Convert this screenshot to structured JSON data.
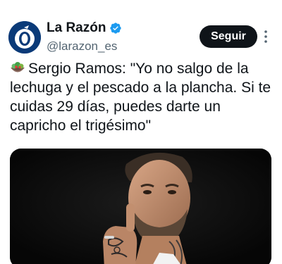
{
  "author": {
    "display_name": "La Razón",
    "handle": "@larazon_es",
    "avatar_icon": "la-razon-logo-icon",
    "verified_icon": "verified-badge-icon",
    "verified_color": "#1d9bf0"
  },
  "actions": {
    "follow_label": "Seguir",
    "more_icon": "more-vertical-icon"
  },
  "tweet": {
    "emoji_icon": "salad-emoji-icon",
    "text": "Sergio Ramos: \"Yo no salgo de la lechuga y el pescado a la plancha. Si te cuidas 29 días, puedes darte un capricho el trigésimo\""
  },
  "media": {
    "image_icon": "sergio-ramos-photo"
  }
}
